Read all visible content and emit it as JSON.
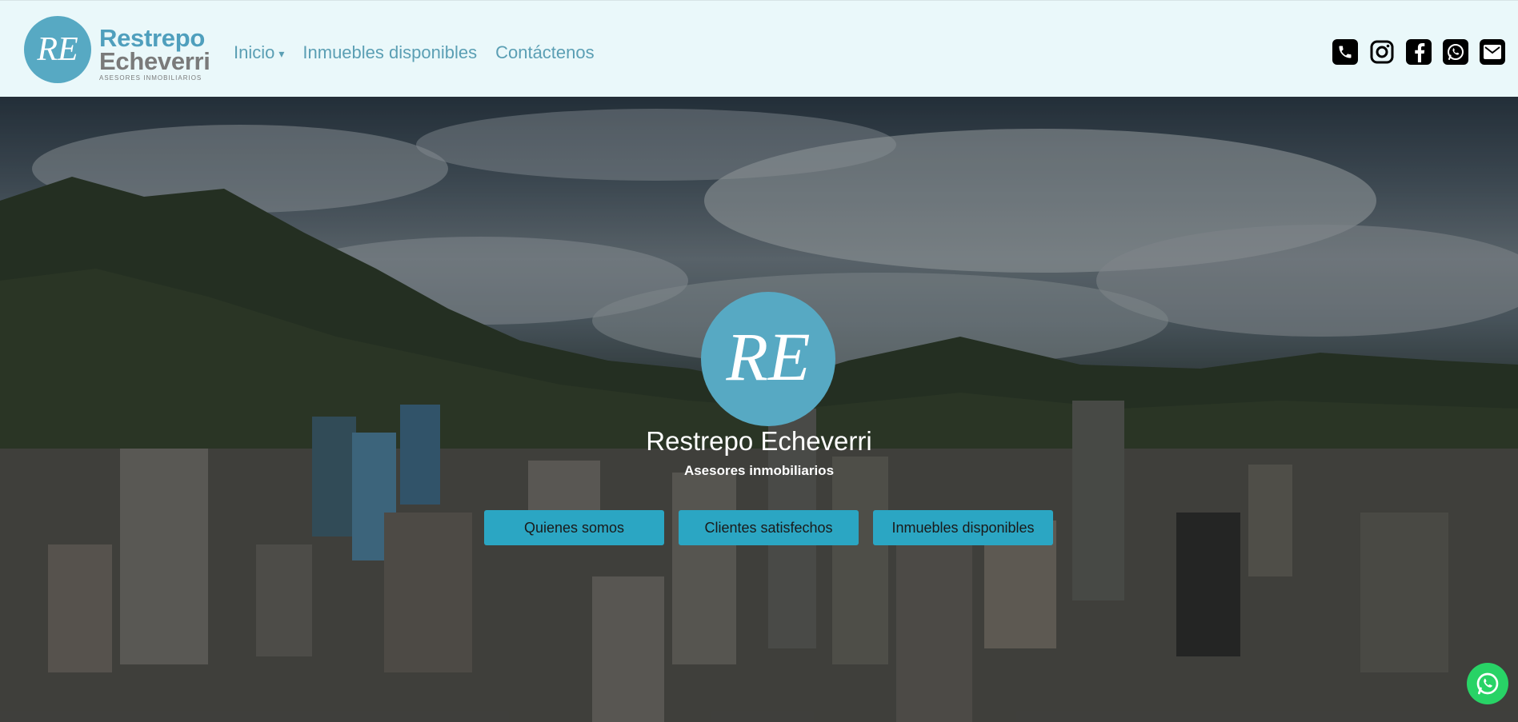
{
  "header": {
    "brand": {
      "monogram": "RE",
      "name_line1": "Restrepo",
      "name_line2": "Echeverri",
      "tagline": "ASESORES INMOBILIARIOS"
    },
    "nav": {
      "home_label": "Inicio",
      "home_caret": "▾",
      "properties_label": "Inmuebles disponibles",
      "contact_label": "Contáctenos"
    },
    "social_icons": [
      "phone-icon",
      "instagram-icon",
      "facebook-icon",
      "whatsapp-icon",
      "email-icon"
    ]
  },
  "hero": {
    "logo_monogram": "RE",
    "title": "Restrepo Echeverri",
    "subtitle": "Asesores inmobiliarios",
    "buttons": {
      "about": "Quienes somos",
      "clients": "Clientes satisfechos",
      "properties": "Inmuebles disponibles"
    }
  },
  "floating": {
    "icon": "whatsapp-icon"
  },
  "colors": {
    "accent": "#2ba6c3",
    "brand_teal": "#57a9c3",
    "nav_bg": "#eaf8fa",
    "nav_link": "#5b9fb4",
    "whatsapp_green": "#28d366"
  }
}
